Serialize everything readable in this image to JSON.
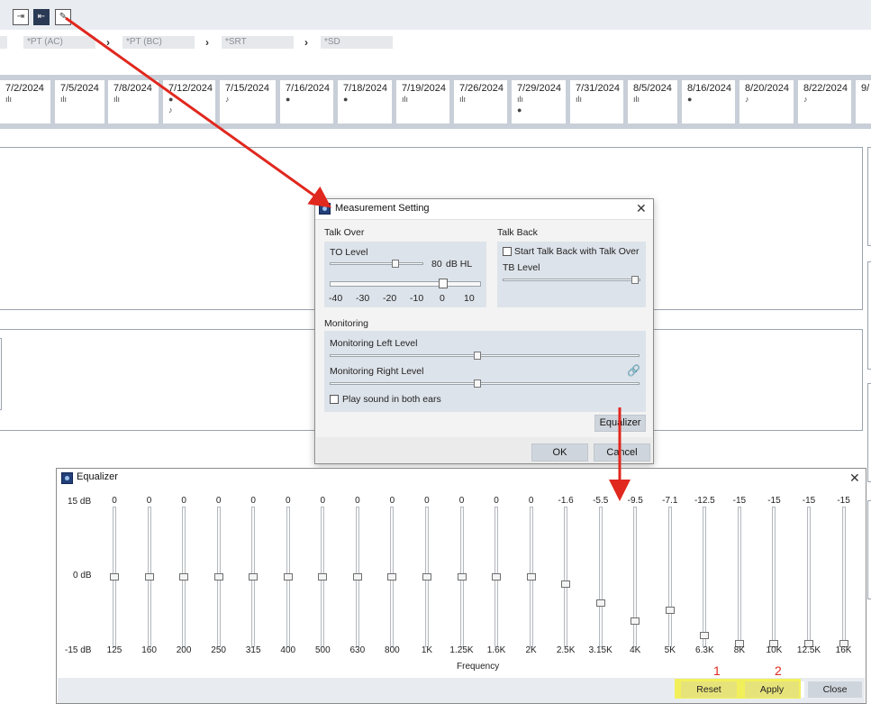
{
  "breadcrumbs": [
    "*PT (AC)",
    "*PT (BC)",
    "*SRT",
    "*SD"
  ],
  "dates": [
    "7/2/2024",
    "7/5/2024",
    "7/8/2024",
    "7/12/2024",
    "7/15/2024",
    "7/16/2024",
    "7/18/2024",
    "7/19/2024",
    "7/26/2024",
    "7/29/2024",
    "7/31/2024",
    "8/5/2024",
    "8/16/2024",
    "8/20/2024",
    "8/22/2024",
    "9/"
  ],
  "measurement_setting": {
    "title": "Measurement Setting",
    "talk_over": {
      "header": "Talk Over",
      "to_level_label": "TO Level",
      "to_level_value": "80",
      "to_level_unit": "dB HL",
      "scale_ticks": [
        "-40",
        "-30",
        "-20",
        "-10",
        "0",
        "10"
      ],
      "scale_value": 0
    },
    "talk_back": {
      "header": "Talk Back",
      "checkbox_label": "Start Talk Back with Talk Over",
      "checked": false,
      "tb_level_label": "TB Level"
    },
    "monitoring": {
      "header": "Monitoring",
      "left_label": "Monitoring Left Level",
      "right_label": "Monitoring Right Level",
      "both_ears_label": "Play sound in both ears",
      "both_ears_checked": false
    },
    "equalizer_button": "Equalizer",
    "ok_button": "OK",
    "cancel_button": "Cancel"
  },
  "equalizer": {
    "title": "Equalizer",
    "db_labels": {
      "top": "15 dB",
      "mid": "0 dB",
      "bottom": "-15 dB"
    },
    "range": [
      -15,
      15
    ],
    "bands": [
      {
        "freq": "125",
        "value": 0
      },
      {
        "freq": "160",
        "value": 0
      },
      {
        "freq": "200",
        "value": 0
      },
      {
        "freq": "250",
        "value": 0
      },
      {
        "freq": "315",
        "value": 0
      },
      {
        "freq": "400",
        "value": 0
      },
      {
        "freq": "500",
        "value": 0
      },
      {
        "freq": "630",
        "value": 0
      },
      {
        "freq": "800",
        "value": 0
      },
      {
        "freq": "1K",
        "value": 0
      },
      {
        "freq": "1.25K",
        "value": 0
      },
      {
        "freq": "1.6K",
        "value": 0
      },
      {
        "freq": "2K",
        "value": 0
      },
      {
        "freq": "2.5K",
        "value": -1.6
      },
      {
        "freq": "3.15K",
        "value": -5.5
      },
      {
        "freq": "4K",
        "value": -9.5
      },
      {
        "freq": "5K",
        "value": -7.1
      },
      {
        "freq": "6.3K",
        "value": -12.5
      },
      {
        "freq": "8K",
        "value": -15
      },
      {
        "freq": "10K",
        "value": -15
      },
      {
        "freq": "12.5K",
        "value": -15
      },
      {
        "freq": "16K",
        "value": -15
      }
    ],
    "xlabel": "Frequency",
    "reset_button": "Reset",
    "apply_button": "Apply",
    "close_button": "Close",
    "step_reset": "1",
    "step_apply": "2"
  },
  "colors": {
    "highlight": "#f2f05a",
    "arrow": "#e0281e"
  }
}
